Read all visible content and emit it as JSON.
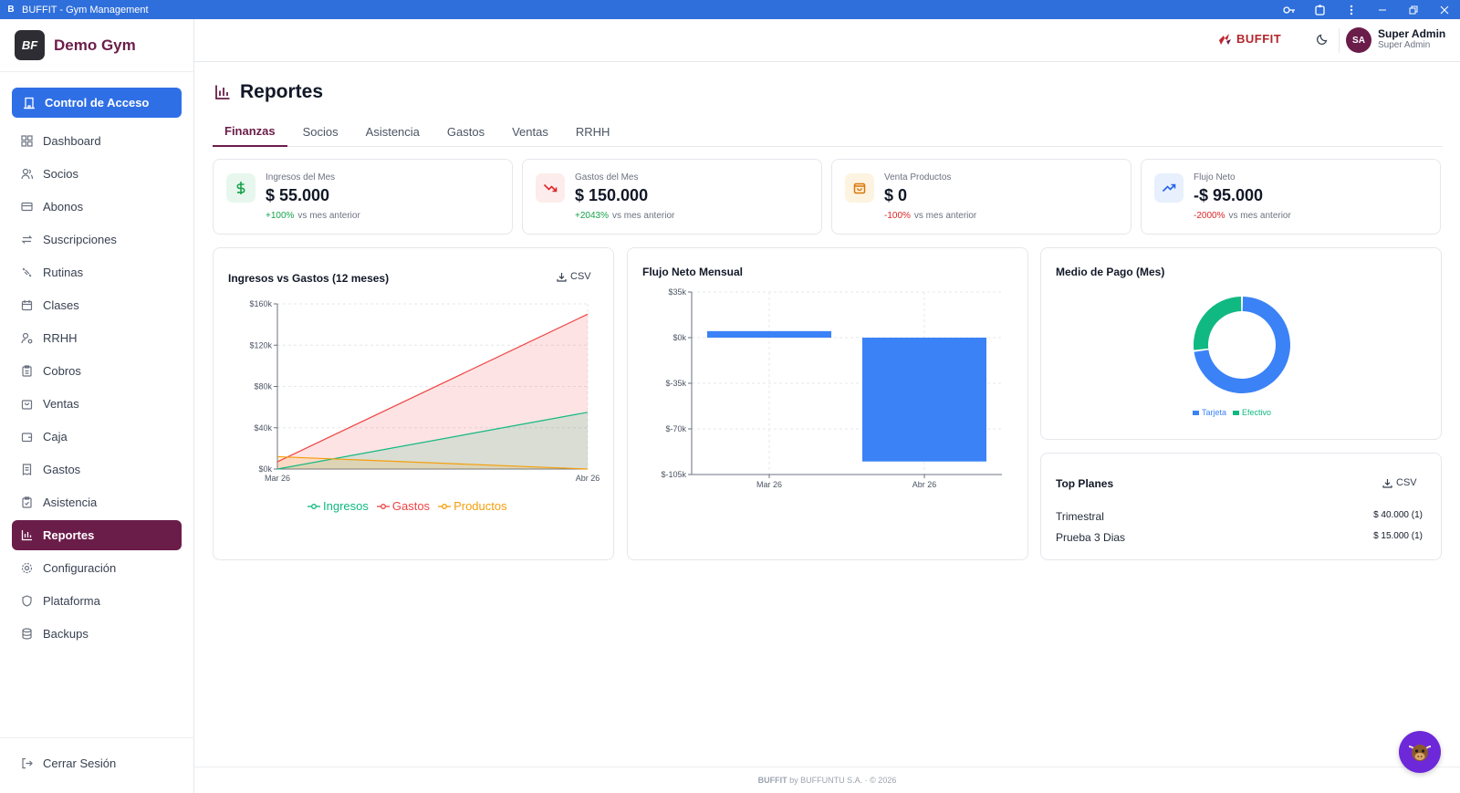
{
  "window": {
    "title": "BUFFIT - Gym Management",
    "logo_letter": "B"
  },
  "sidebar": {
    "brand_name": "Demo Gym",
    "brand_logo_text": "BF",
    "access_button": "Control de Acceso",
    "items": [
      {
        "label": "Dashboard",
        "icon": "grid-icon"
      },
      {
        "label": "Socios",
        "icon": "users-icon"
      },
      {
        "label": "Abonos",
        "icon": "card-icon"
      },
      {
        "label": "Suscripciones",
        "icon": "repeat-icon"
      },
      {
        "label": "Rutinas",
        "icon": "dumbbell-icon"
      },
      {
        "label": "Clases",
        "icon": "calendar-icon"
      },
      {
        "label": "RRHH",
        "icon": "user-cog-icon"
      },
      {
        "label": "Cobros",
        "icon": "clipboard-icon"
      },
      {
        "label": "Ventas",
        "icon": "bag-icon"
      },
      {
        "label": "Caja",
        "icon": "wallet-icon"
      },
      {
        "label": "Gastos",
        "icon": "receipt-icon"
      },
      {
        "label": "Asistencia",
        "icon": "clipboard-check-icon"
      },
      {
        "label": "Reportes",
        "icon": "bar-chart-icon",
        "active": true
      },
      {
        "label": "Configuración",
        "icon": "gear-icon"
      },
      {
        "label": "Plataforma",
        "icon": "shield-icon"
      },
      {
        "label": "Backups",
        "icon": "database-icon"
      }
    ],
    "logout": "Cerrar Sesión"
  },
  "header": {
    "brand_text": "BUFFIT",
    "avatar_initials": "SA",
    "user_name": "Super Admin",
    "user_role": "Super Admin"
  },
  "page": {
    "title": "Reportes",
    "tabs": [
      "Finanzas",
      "Socios",
      "Asistencia",
      "Gastos",
      "Ventas",
      "RRHH"
    ],
    "active_tab": "Finanzas"
  },
  "kpis": [
    {
      "label": "Ingresos del Mes",
      "value": "$ 55.000",
      "change": "+100%",
      "trend": "positive",
      "suffix": "vs mes anterior",
      "color": "#16a34a"
    },
    {
      "label": "Gastos del Mes",
      "value": "$ 150.000",
      "change": "+2043%",
      "trend": "positive",
      "suffix": "vs mes anterior",
      "color": "#dc2626"
    },
    {
      "label": "Venta Productos",
      "value": "$ 0",
      "change": "-100%",
      "trend": "negative",
      "suffix": "vs mes anterior",
      "color": "#d97706"
    },
    {
      "label": "Flujo Neto",
      "value": "-$ 95.000",
      "change": "-2000%",
      "trend": "negative",
      "suffix": "vs mes anterior",
      "color": "#2563eb"
    }
  ],
  "cards": {
    "income_vs_expenses": {
      "title": "Ingresos vs Gastos (12 meses)",
      "csv": "CSV"
    },
    "net_flow": {
      "title": "Flujo Neto Mensual"
    },
    "payment_method": {
      "title": "Medio de Pago (Mes)"
    },
    "top_plans": {
      "title": "Top Planes",
      "csv": "CSV",
      "rows": [
        {
          "name": "Trimestral",
          "value": "$ 40.000 (1)"
        },
        {
          "name": "Prueba 3 Dias",
          "value": "$ 15.000 (1)"
        }
      ]
    }
  },
  "chart_data": [
    {
      "type": "area",
      "title": "Ingresos vs Gastos (12 meses)",
      "categories": [
        "Mar 26",
        "Abr 26"
      ],
      "yticks": [
        "$0k",
        "$40k",
        "$80k",
        "$120k",
        "$160k"
      ],
      "ylim": [
        0,
        160000
      ],
      "series": [
        {
          "name": "Ingresos",
          "values": [
            0,
            55000
          ],
          "color": "#10b981"
        },
        {
          "name": "Gastos",
          "values": [
            7000,
            150000
          ],
          "color": "#ef4444"
        },
        {
          "name": "Productos",
          "values": [
            12000,
            0
          ],
          "color": "#f59e0b"
        }
      ],
      "legend": "bottom",
      "grid": true
    },
    {
      "type": "bar",
      "title": "Flujo Neto Mensual",
      "categories": [
        "Mar 26",
        "Abr 26"
      ],
      "values": [
        5000,
        -95000
      ],
      "yticks": [
        "$35k",
        "$0k",
        "$-35k",
        "$-70k",
        "$-105k"
      ],
      "ylim": [
        -105000,
        35000
      ],
      "color": "#3b82f6",
      "grid": true
    },
    {
      "type": "pie",
      "title": "Medio de Pago (Mes)",
      "labels": [
        "Tarjeta",
        "Efectivo"
      ],
      "values": [
        73,
        27
      ],
      "colors": [
        "#3b82f6",
        "#10b981"
      ],
      "legend": "bottom"
    }
  ],
  "footer": {
    "brand": "BUFFIT",
    "text": "by BUFFUNTU S.A. · © 2026"
  }
}
